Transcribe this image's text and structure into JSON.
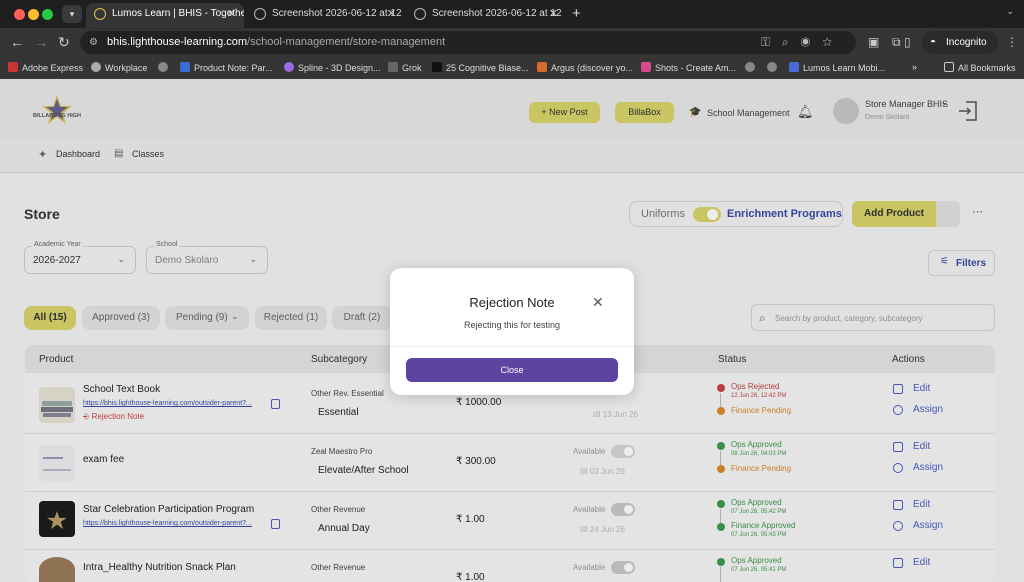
{
  "browser": {
    "tabs": [
      {
        "title": "Lumos Learn | BHIS - Togethe",
        "active": true
      },
      {
        "title": "Screenshot 2026-06-12 at 12",
        "active": false
      },
      {
        "title": "Screenshot 2026-06-12 at 12",
        "active": false
      }
    ],
    "url_host": "bhis.lighthouse-learning.com",
    "url_path": "/school-management/store-management",
    "incognito_label": "Incognito",
    "bookmarks": [
      "Adobe Express",
      "Workplace",
      "Product Note: Par...",
      "Spline - 3D Design...",
      "Grok",
      "25 Cognitive Biase...",
      "Argus (discover yo...",
      "Shots - Create Am...",
      "Lumos Learn Mobi..."
    ],
    "all_bookmarks": "All Bookmarks"
  },
  "header": {
    "logo_text": "BILLABONG HIGH",
    "new_post": "+ New Post",
    "billabox": "BillaBox",
    "school_management": "School Management",
    "user_name": "Store Manager BHIS",
    "user_school": "Demo Skolaro"
  },
  "subnav": {
    "dashboard": "Dashboard",
    "classes": "Classes"
  },
  "page": {
    "title": "Store",
    "toggle_left": "Uniforms",
    "toggle_right": "Enrichment Programs",
    "add_product": "Add Product",
    "academic_year_label": "Academic Year",
    "academic_year": "2026-2027",
    "school_label": "School",
    "school": "Demo Skolaro",
    "filters": "Filters",
    "search_placeholder": "Search by product, category, subcategory"
  },
  "filters": [
    {
      "label": "All (15)",
      "active": true
    },
    {
      "label": "Approved (3)",
      "active": false
    },
    {
      "label": "Pending (9)",
      "active": false
    },
    {
      "label": "Rejected (1)",
      "active": false
    },
    {
      "label": "Draft (2)",
      "active": false
    }
  ],
  "table": {
    "headers": {
      "product": "Product",
      "subcategory": "Subcategory",
      "status": "Status",
      "actions": "Actions"
    },
    "rows": [
      {
        "name": "School Text Book",
        "link": "https://bhis.lighthouse-learning.com/outsider-parent?...",
        "rejection_note": "Rejection Note",
        "subcat_group": "Other Rev. Essential",
        "subcat": "Essential",
        "price": "₹ 1000.00",
        "avail": "",
        "till": "till 13 Jun 26",
        "status1": "Ops Rejected",
        "status1_date": "12 Jun 26, 12:42 PM",
        "status2": "Finance Pending",
        "status2_date": ""
      },
      {
        "name": "exam fee",
        "link": "",
        "rejection_note": "",
        "subcat_group": "Zeal Maestro Pro",
        "subcat": "Elevate/After School",
        "price": "₹ 300.00",
        "avail": "Available",
        "till": "till 03 Jun 26",
        "status1": "Ops Approved",
        "status1_date": "08 Jun 26, 04:03 PM",
        "status2": "Finance Pending",
        "status2_date": ""
      },
      {
        "name": "Star Celebration Participation Program",
        "link": "https://bhis.lighthouse-learning.com/outsider-parent?...",
        "rejection_note": "",
        "subcat_group": "Other Revenue",
        "subcat": "Annual Day",
        "price": "₹ 1.00",
        "avail": "Available",
        "till": "till 24 Jun 26",
        "status1": "Ops Approved",
        "status1_date": "07 Jun 26, 05:42 PM",
        "status2": "Finance Approved",
        "status2_date": "07 Jun 26, 05:43 PM"
      },
      {
        "name": "Intra_Healthy Nutrition Snack Plan",
        "link": "",
        "rejection_note": "",
        "subcat_group": "Other Revenue",
        "subcat": "",
        "price": "₹ 1.00",
        "avail": "Available",
        "till": "",
        "status1": "Ops Approved",
        "status1_date": "07 Jun 26, 05:41 PM",
        "status2": "",
        "status2_date": ""
      }
    ],
    "edit": "Edit",
    "assign": "Assign"
  },
  "modal": {
    "title": "Rejection Note",
    "message": "Rejecting this for testing",
    "close_button": "Close"
  },
  "colors": {
    "accent_yellow": "#d8d46a",
    "modal_button": "#5d44a0",
    "link_blue": "#3a4aa8",
    "rejected_red": "#c44444",
    "approved_green": "#3e9a4e",
    "pending_orange": "#d88a2a"
  }
}
